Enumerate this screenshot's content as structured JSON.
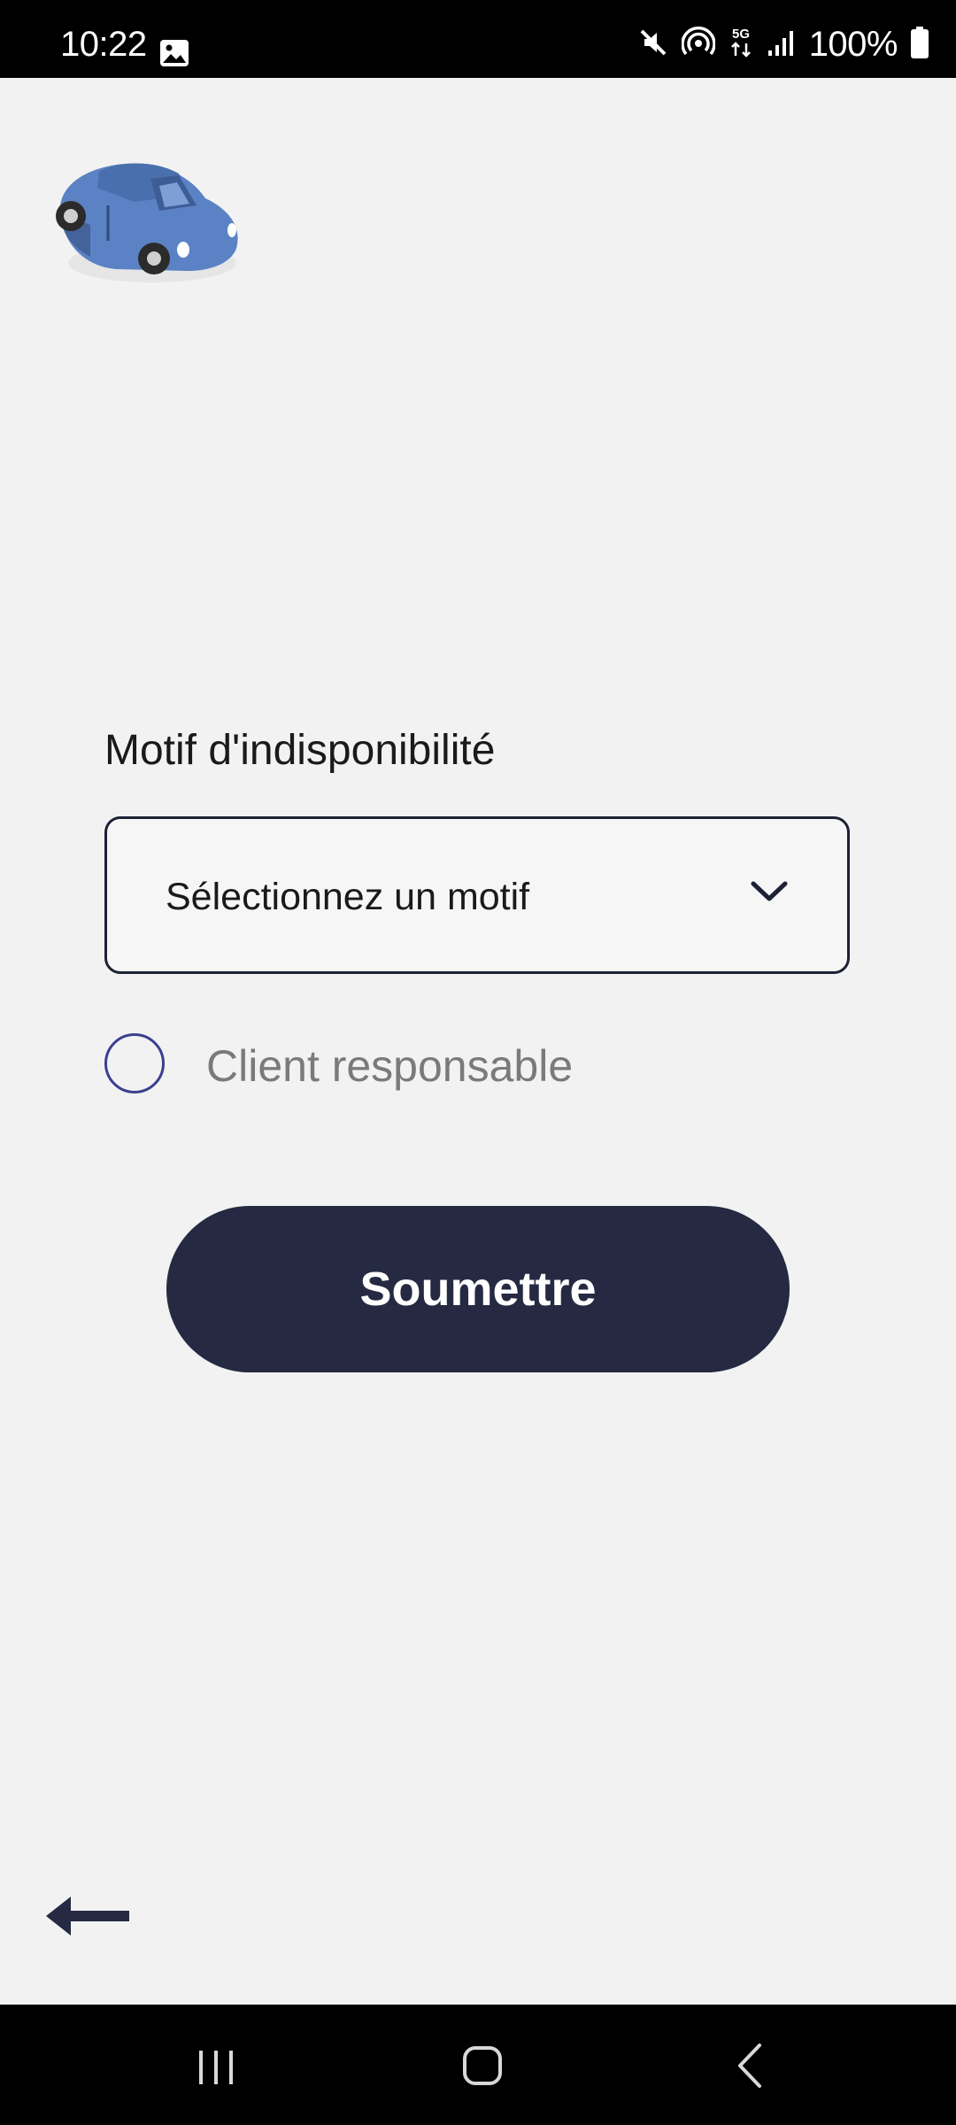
{
  "status_bar": {
    "time": "10:22",
    "battery": "100%",
    "icons": [
      "gallery-icon",
      "mute-icon",
      "hotspot-icon",
      "5g-icon",
      "signal-icon",
      "battery-icon"
    ]
  },
  "logo": {
    "icon": "car-icon",
    "color": "#5b82c4"
  },
  "form": {
    "label": "Motif d'indisponibilité",
    "select": {
      "value": "Sélectionnez un motif",
      "icon": "chevron-down-icon"
    },
    "checkbox": {
      "label": "Client responsable",
      "checked": false
    },
    "submit_label": "Soumettre"
  },
  "navigation": {
    "back_icon": "arrow-left-icon",
    "system": [
      "recent-apps-icon",
      "home-icon",
      "back-icon"
    ]
  },
  "colors": {
    "primary": "#252a42",
    "background": "#f2f2f2",
    "radio_border": "#3c3f8f",
    "muted_text": "#7a7a7a"
  }
}
